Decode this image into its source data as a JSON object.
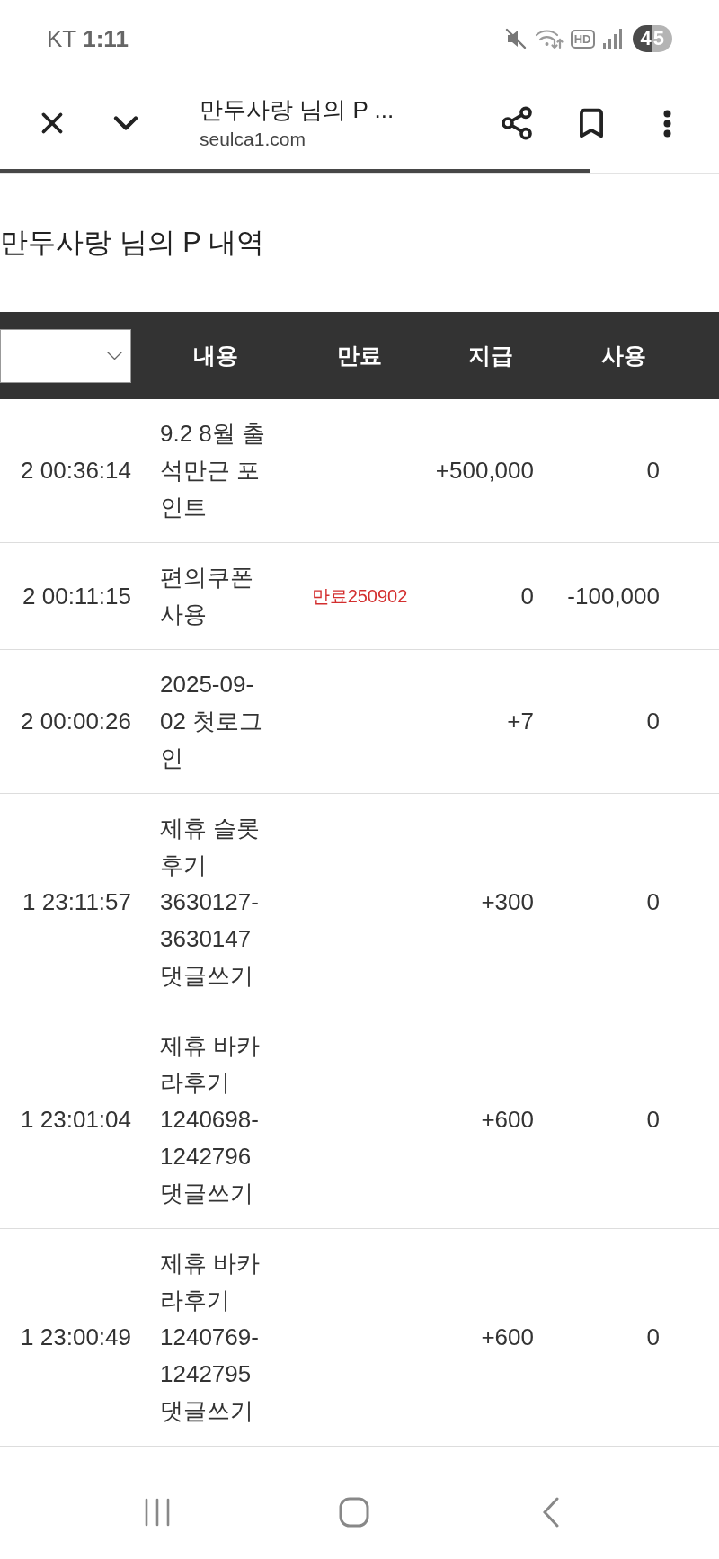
{
  "status_bar": {
    "carrier": "KT",
    "time": "1:11",
    "hd_label": "HD",
    "battery": "45"
  },
  "browser_bar": {
    "title": "만두사랑 님의 P ...",
    "url": "seulca1.com",
    "load_progress": {
      "level": 0.82
    }
  },
  "page": {
    "title": "만두사랑 님의 P 내역"
  },
  "table": {
    "columns": [
      "내용",
      "만료",
      "지급",
      "사용"
    ],
    "rows": [
      {
        "time": "2 00:36:14",
        "content": "9.2 8월 출석만근 포인트",
        "paid": "+500,000",
        "used": "0"
      },
      {
        "time": "2 00:11:15",
        "content": "편의쿠폰 사용",
        "expiry": "만료250902",
        "paid": "0",
        "used": "-100,000"
      },
      {
        "time": "2 00:00:26",
        "content": "2025-09-02 첫로그인",
        "paid": "+7",
        "used": "0"
      },
      {
        "time": "1 23:11:57",
        "content": "제휴 슬롯 후기 3630127-3630147 댓글쓰기",
        "paid": "+300",
        "used": "0"
      },
      {
        "time": "1 23:01:04",
        "content": "제휴 바카라후기 1240698-1242796 댓글쓰기",
        "paid": "+600",
        "used": "0"
      },
      {
        "time": "1 23:00:49",
        "content": "제휴 바카라후기 1240769-1242795 댓글쓰기",
        "paid": "+600",
        "used": "0"
      }
    ]
  }
}
